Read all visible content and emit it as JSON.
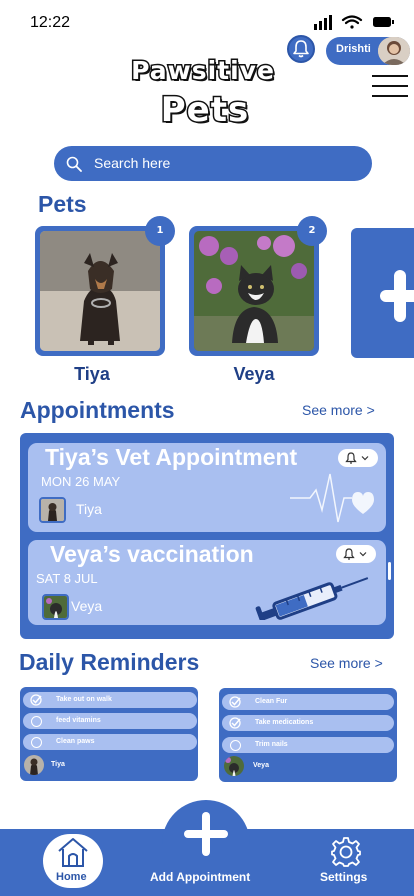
{
  "status_bar": {
    "time": "12:22"
  },
  "header": {
    "logo_line1": "Pawsitive",
    "logo_line2": "Pets",
    "user_name": "Drishti"
  },
  "search": {
    "placeholder": "Search here"
  },
  "pets": {
    "title": "Pets",
    "items": [
      {
        "name": "Tiya",
        "badge": "1"
      },
      {
        "name": "Veya",
        "badge": "2"
      }
    ]
  },
  "appointments": {
    "title": "Appointments",
    "see_more": "See more >",
    "items": [
      {
        "title": "Tiya’s Vet Appointment",
        "date": "MON 26 MAY",
        "pet": "Tiya"
      },
      {
        "title": "Veya’s vaccination",
        "date": "SAT 8 JUL",
        "pet": "Veya"
      }
    ]
  },
  "reminders": {
    "title": "Daily Reminders",
    "see_more": "See more >",
    "cards": [
      {
        "pet": "Tiya",
        "tasks": [
          {
            "label": "Take out on walk",
            "done": true
          },
          {
            "label": "feed vitamins",
            "done": false
          },
          {
            "label": "Clean paws",
            "done": false
          }
        ]
      },
      {
        "pet": "Veya",
        "tasks": [
          {
            "label": "Clean Fur",
            "done": true
          },
          {
            "label": "Take medications",
            "done": true
          },
          {
            "label": "Trim nails",
            "done": false
          }
        ]
      }
    ]
  },
  "nav": {
    "home": "Home",
    "add": "Add Appointment",
    "settings": "Settings"
  },
  "colors": {
    "primary": "#3f6cc3",
    "light": "#a9bff0",
    "text": "#1f3f86"
  }
}
